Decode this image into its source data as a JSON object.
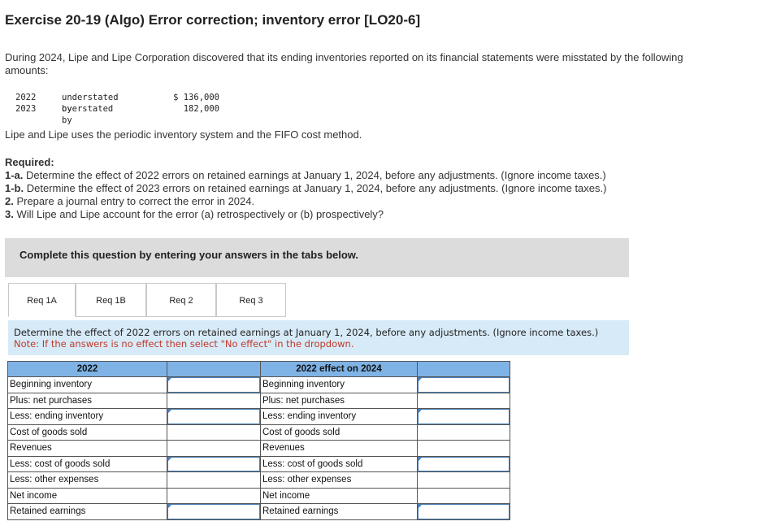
{
  "exercise": {
    "title": "Exercise 20-19 (Algo) Error correction; inventory error [LO20-6]",
    "intro": "During 2024, Lipe and Lipe Corporation discovered that its ending inventories reported on its financial statements were misstated by the following amounts:",
    "amounts": [
      {
        "year": "2022",
        "desc": "understated by",
        "value": "$ 136,000"
      },
      {
        "year": "2023",
        "desc": "overstated by",
        "value": "  182,000"
      }
    ],
    "method": "Lipe and Lipe uses the periodic inventory system and the FIFO cost method.",
    "required_header": "Required:",
    "requirements": [
      {
        "num": "1-a.",
        "text": " Determine the effect of 2022 errors on retained earnings at January 1, 2024, before any adjustments. (Ignore income taxes.)"
      },
      {
        "num": "1-b.",
        "text": " Determine the effect of 2023 errors on retained earnings at January 1, 2024, before any adjustments. (Ignore income taxes.)"
      },
      {
        "num": "2.",
        "text": " Prepare a journal entry to correct the error in 2024."
      },
      {
        "num": "3.",
        "text": " Will Lipe and Lipe account for the error (a) retrospectively or (b) prospectively?"
      }
    ]
  },
  "banner": "Complete this question by entering your answers in the tabs below.",
  "tabs": [
    "Req 1A",
    "Req 1B",
    "Req 2",
    "Req 3"
  ],
  "instruction": {
    "text": "Determine the effect of 2022 errors on retained earnings at January 1, 2024, before any adjustments. (Ignore income taxes.)",
    "note": "Note: If the answers is no effect then select \"No effect\" in the dropdown."
  },
  "table": {
    "left_header": "2022",
    "right_header": "2022 effect on 2024",
    "rows": [
      {
        "left": "Beginning inventory",
        "right": "Beginning inventory"
      },
      {
        "left": "Plus: net purchases",
        "right": "Plus: net purchases"
      },
      {
        "left": "Less: ending inventory",
        "right": "Less: ending inventory"
      },
      {
        "left": "Cost of goods sold",
        "right": "Cost of goods sold"
      },
      {
        "left": "Revenues",
        "right": "Revenues"
      },
      {
        "left": "Less: cost of goods sold",
        "right": "Less: cost of goods sold"
      },
      {
        "left": "Less: other expenses",
        "right": "Less: other expenses"
      },
      {
        "left": "Net income",
        "right": "Net income"
      },
      {
        "left": "Retained earnings",
        "right": "Retained earnings"
      }
    ]
  }
}
